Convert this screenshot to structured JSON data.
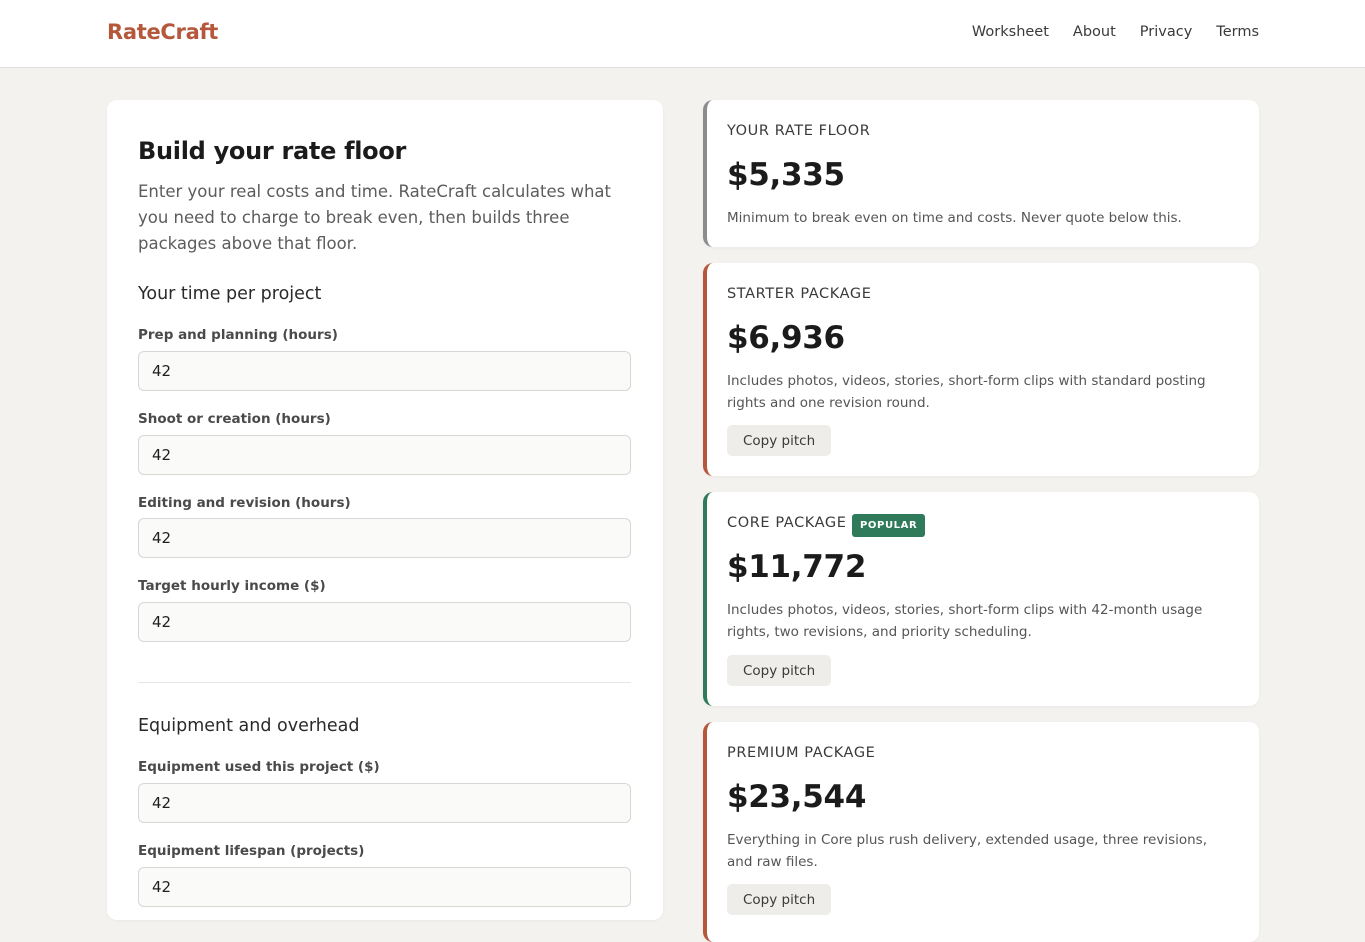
{
  "header": {
    "brand": "RateCraft",
    "nav": [
      "Worksheet",
      "About",
      "Privacy",
      "Terms"
    ]
  },
  "form": {
    "title": "Build your rate floor",
    "intro": "Enter your real costs and time. RateCraft calculates what you need to charge to break even, then builds three packages above that floor.",
    "section_time": "Your time per project",
    "fields": [
      {
        "label": "Prep and planning (hours)",
        "value": "42"
      },
      {
        "label": "Shoot or creation (hours)",
        "value": "42"
      },
      {
        "label": "Editing and revision (hours)",
        "value": "42"
      },
      {
        "label": "Target hourly income ($)",
        "value": "42"
      }
    ],
    "section_equipment": "Equipment and overhead",
    "equipment_fields": [
      {
        "label": "Equipment used this project ($)",
        "value": "42"
      },
      {
        "label": "Equipment lifespan (projects)",
        "value": "42"
      }
    ]
  },
  "results": {
    "floor": {
      "label": "YOUR RATE FLOOR",
      "price": "$5,335",
      "desc": "Minimum to break even on time and costs. Never quote below this."
    },
    "packages": [
      {
        "label": "STARTER PACKAGE",
        "price": "$6,936",
        "desc": "Includes photos, videos, stories, short-form clips with standard posting rights and one revision round.",
        "button": "Copy pitch"
      },
      {
        "label": "CORE PACKAGE",
        "badge": "POPULAR",
        "price": "$11,772",
        "desc": "Includes photos, videos, stories, short-form clips with 42-month usage rights, two revisions, and priority scheduling.",
        "button": "Copy pitch"
      },
      {
        "label": "PREMIUM PACKAGE",
        "price": "$23,544",
        "desc": "Everything in Core plus rush delivery, extended usage, three revisions, and raw files.",
        "button": "Copy pitch"
      }
    ]
  },
  "colors": {
    "accent": "#b5573a",
    "popular": "#2f7a5b",
    "floor_border": "#8c8c8c",
    "background": "#f3f2ef"
  }
}
